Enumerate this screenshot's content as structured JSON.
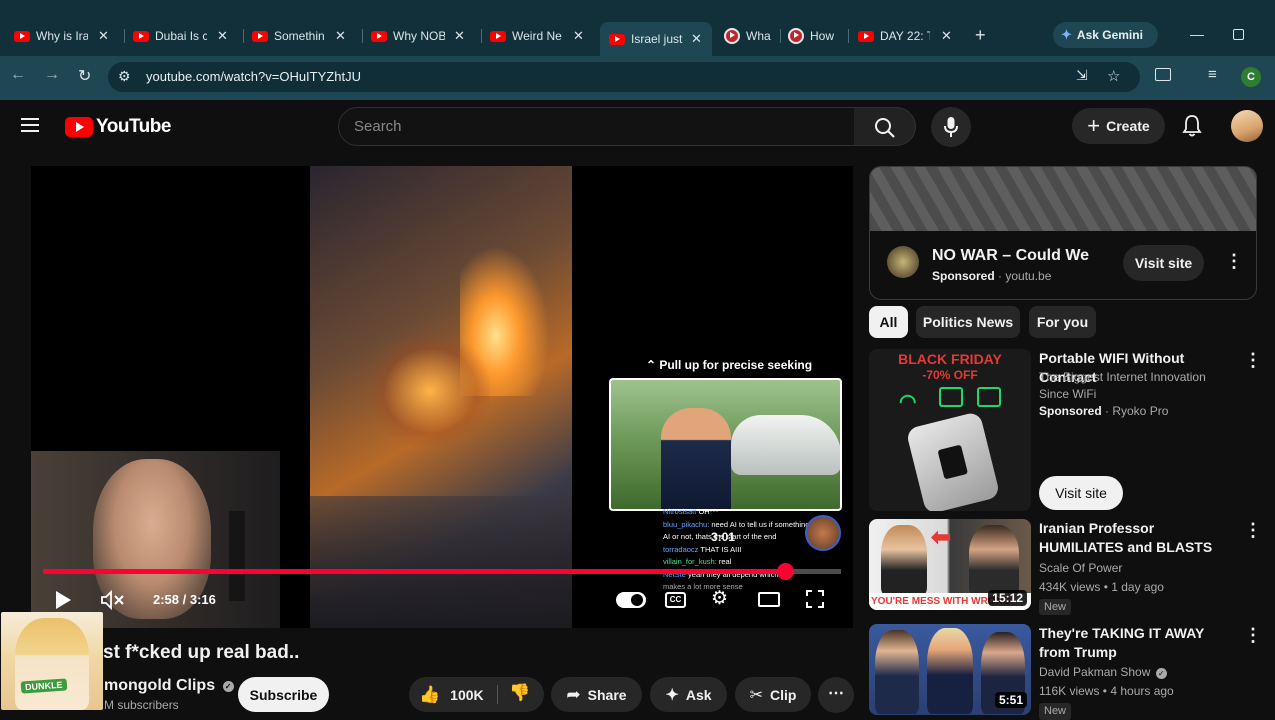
{
  "browser": {
    "tabs": [
      {
        "title": "Why is Ira",
        "active": false
      },
      {
        "title": "Dubai Is c",
        "active": false
      },
      {
        "title": "Somethin",
        "active": false
      },
      {
        "title": "Why NOB",
        "active": false
      },
      {
        "title": "Weird Ne",
        "active": false
      },
      {
        "title": "Israel just",
        "active": true
      },
      {
        "title": "Wha",
        "active": false
      },
      {
        "title": "How",
        "active": false
      },
      {
        "title": "DAY 22: T",
        "active": false
      }
    ],
    "new_tab": "+",
    "gemini_label": "Ask Gemini",
    "url": "youtube.com/watch?v=OHuITYZhtJU",
    "profile_letter": "C"
  },
  "header": {
    "logo_text": "YouTube",
    "search_placeholder": "Search",
    "create_label": "Create"
  },
  "player": {
    "seek_hint": "Pull up for precise seeking",
    "preview_time": "3:01",
    "time_display": "2:58 / 3:16",
    "progress_fraction": 0.93,
    "chat": [
      {
        "user": "Nitrosisatt",
        "text": "OH***"
      },
      {
        "user": "bluu_pikachu:",
        "text": "need AI to tell us if something is"
      },
      {
        "user": "",
        "text": "AI or not, thats the start of the end"
      },
      {
        "user": "torradaocz",
        "text": "THAT IS AIII"
      },
      {
        "user": "villain_for_kush:",
        "text": "real"
      },
      {
        "user": "NetSte",
        "text": "yeah they all depend which"
      },
      {
        "user": "",
        "text": "makes a lot more sense"
      }
    ]
  },
  "video": {
    "title": "st f*cked up real bad..",
    "channel": "mongold Clips",
    "subscribers": "M subscribers",
    "subscribe_label": "Subscribe",
    "likes": "100K",
    "share_label": "Share",
    "ask_label": "Ask",
    "clip_label": "Clip",
    "overlay_badge": "DUNKLE"
  },
  "ad": {
    "title": "NO WAR – Could We",
    "sponsored": "Sponsored",
    "domain": "youtu.be",
    "cta": "Visit site"
  },
  "chips": [
    "All",
    "Politics News",
    "For you"
  ],
  "recommendations": [
    {
      "title": "Portable WIFI Without Contract",
      "meta1": "The Biggest Internet Innovation Since WiFi",
      "sponsored": "Sponsored",
      "channel": "Ryoko Pro",
      "cta": "Visit site",
      "thumb_text1": "BLACK FRIDAY",
      "thumb_text2": "-70% OFF"
    },
    {
      "title": "Iranian Professor HUMILIATES and BLASTS Times Reporter t...",
      "channel": "Scale Of Power",
      "stats": "434K views • 1 day ago",
      "badge": "New",
      "duration": "15:12",
      "thumb_text": "YOU'RE MESS WITH WRONG"
    },
    {
      "title": "They're TAKING IT AWAY from Trump",
      "channel": "David Pakman Show",
      "stats": "116K views • 4 hours ago",
      "badge": "New",
      "duration": "5:51"
    }
  ]
}
